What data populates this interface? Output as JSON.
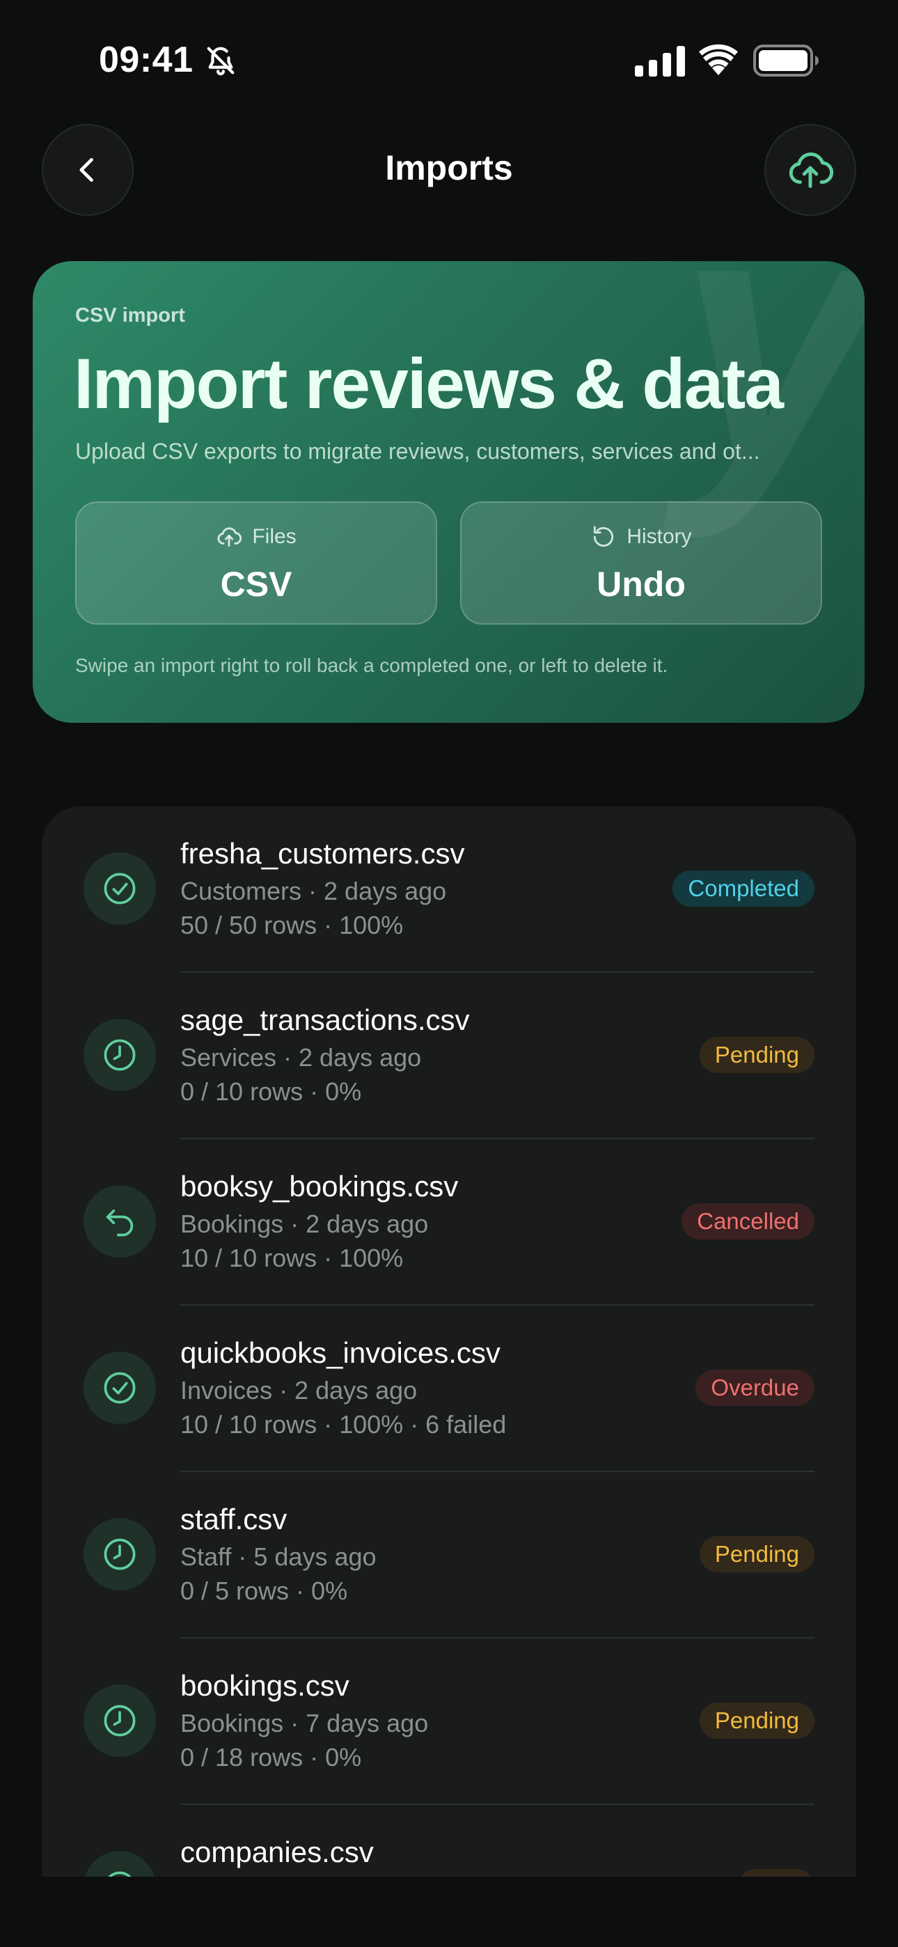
{
  "status_bar": {
    "time": "09:41",
    "icons": [
      "bell-slash-icon",
      "signal-icon",
      "wifi-icon",
      "battery-icon"
    ]
  },
  "nav": {
    "title": "Imports",
    "back_icon": "chevron-left-icon",
    "action_icon": "cloud-upload-icon"
  },
  "hero": {
    "eyebrow": "CSV import",
    "title": "Import reviews & data",
    "subtitle": "Upload CSV exports to migrate reviews, customers, services and ot...",
    "tiles": [
      {
        "icon": "cloud-upload-icon",
        "label": "Files",
        "value": "CSV"
      },
      {
        "icon": "undo-icon",
        "label": "History",
        "value": "Undo"
      }
    ],
    "hint": "Swipe an import right to roll back a completed one, or left to delete it."
  },
  "imports": [
    {
      "icon": "check-circle-icon",
      "name": "fresha_customers.csv",
      "meta": "Customers · 2 days ago",
      "progress": "50 / 50 rows · 100%",
      "status": "Completed",
      "status_kind": "completed"
    },
    {
      "icon": "clock-icon",
      "name": "sage_transactions.csv",
      "meta": "Services · 2 days ago",
      "progress": "0 / 10 rows · 0%",
      "status": "Pending",
      "status_kind": "pending"
    },
    {
      "icon": "undo-icon",
      "name": "booksy_bookings.csv",
      "meta": "Bookings · 2 days ago",
      "progress": "10 / 10 rows · 100%",
      "status": "Cancelled",
      "status_kind": "cancelled"
    },
    {
      "icon": "check-circle-icon",
      "name": "quickbooks_invoices.csv",
      "meta": "Invoices · 2 days ago",
      "progress": "10 / 10 rows · 100% · 6 failed",
      "status": "Overdue",
      "status_kind": "overdue"
    },
    {
      "icon": "clock-icon",
      "name": "staff.csv",
      "meta": "Staff · 5 days ago",
      "progress": "0 / 5 rows · 0%",
      "status": "Pending",
      "status_kind": "pending"
    },
    {
      "icon": "clock-icon",
      "name": "bookings.csv",
      "meta": "Bookings · 7 days ago",
      "progress": "0 / 18 rows · 0%",
      "status": "Pending",
      "status_kind": "pending"
    },
    {
      "icon": "clock-icon",
      "name": "companies.csv",
      "meta": "",
      "progress": "",
      "status": "",
      "status_kind": "pending"
    }
  ],
  "colors": {
    "background": "#0d0f0e",
    "hero_gradient_start": "#2e8a68",
    "hero_gradient_end": "#1b5141",
    "icon_accent": "#5fcf9e",
    "completed": "#4fd1e8",
    "pending": "#f2bb3d",
    "cancelled": "#f07070"
  }
}
